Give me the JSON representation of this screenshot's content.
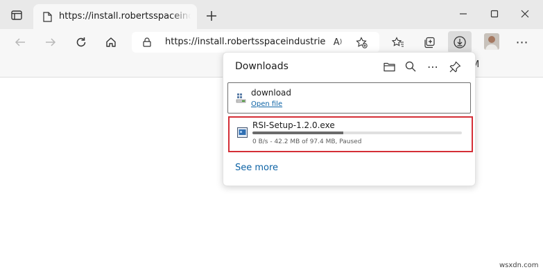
{
  "tab": {
    "title": "https://install.robertsspaceindust"
  },
  "address_bar": {
    "url": "https://install.robertsspaceindustrie..."
  },
  "favorites_bar": {
    "text": "M"
  },
  "downloads": {
    "title": "Downloads",
    "items": [
      {
        "name": "download",
        "action": "Open file"
      },
      {
        "name": "RSI-Setup-1.2.0.exe",
        "progress": 0.433,
        "status": "0 B/s - 42.2 MB of 97.4 MB, Paused"
      }
    ],
    "see_more": "See more"
  },
  "watermark": "wsxdn.com",
  "colors": {
    "highlight": "#d42e36",
    "link": "#0d63a5"
  }
}
